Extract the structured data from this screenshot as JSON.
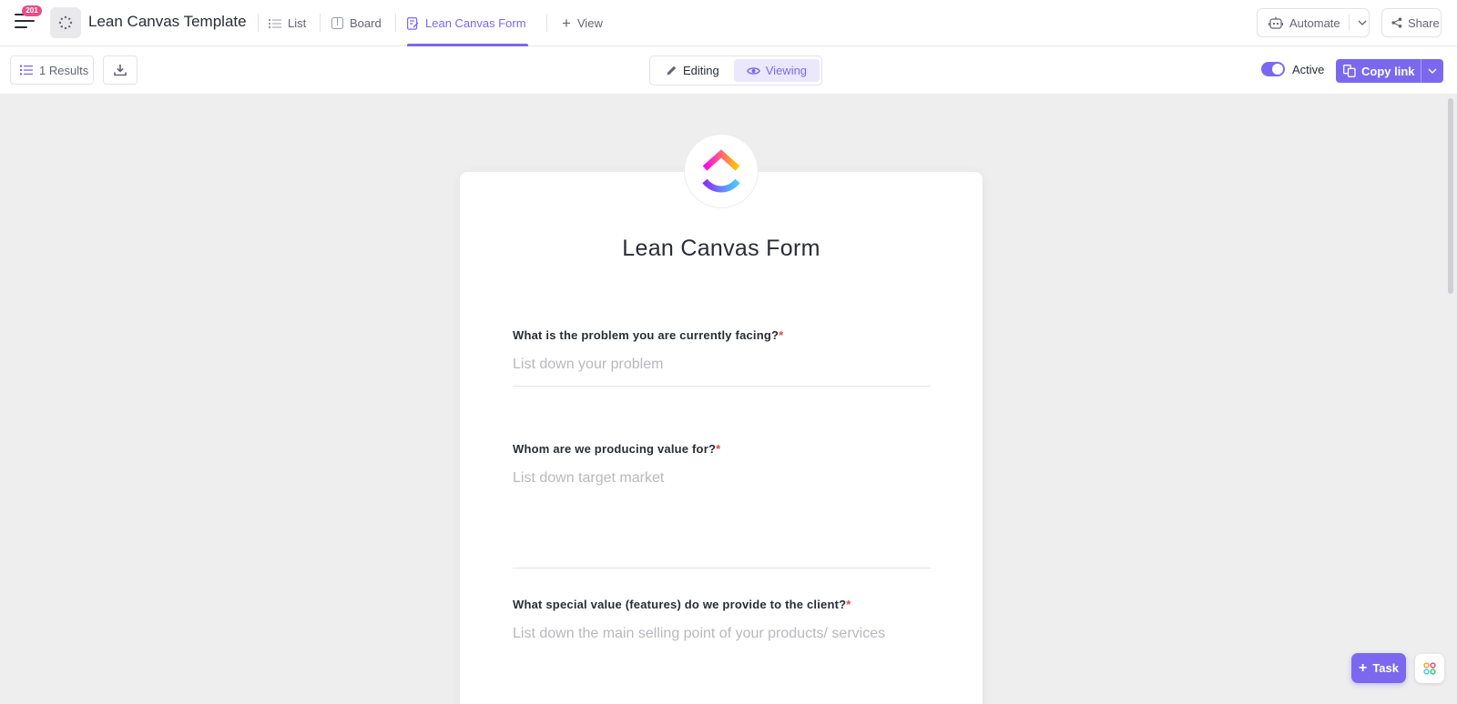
{
  "header": {
    "notification_count": "201",
    "list_title": "Lean Canvas Template",
    "tabs": [
      {
        "label": "List"
      },
      {
        "label": "Board"
      },
      {
        "label": "Lean Canvas Form"
      },
      {
        "label": "View"
      }
    ],
    "automate_label": "Automate",
    "share_label": "Share"
  },
  "toolbar": {
    "results_label": "1 Results",
    "editing_label": "Editing",
    "viewing_label": "Viewing",
    "active_label": "Active",
    "copy_link_label": "Copy link"
  },
  "form": {
    "title": "Lean Canvas Form",
    "fields": [
      {
        "label": "What is the problem you are currently facing?",
        "required_mark": "*",
        "placeholder": "List down your problem"
      },
      {
        "label": "Whom are we producing value for?",
        "required_mark": "*",
        "placeholder": "List down target market"
      },
      {
        "label": "What special value (features) do we provide to the client?",
        "required_mark": "*",
        "placeholder": "List down the main selling point of your products/ services"
      }
    ]
  },
  "floating": {
    "task_label": "Task"
  },
  "colors": {
    "accent": "#7b68ee",
    "required": "#e5484d",
    "badge": "#e84c8a",
    "content_bg": "#eeeeee"
  }
}
